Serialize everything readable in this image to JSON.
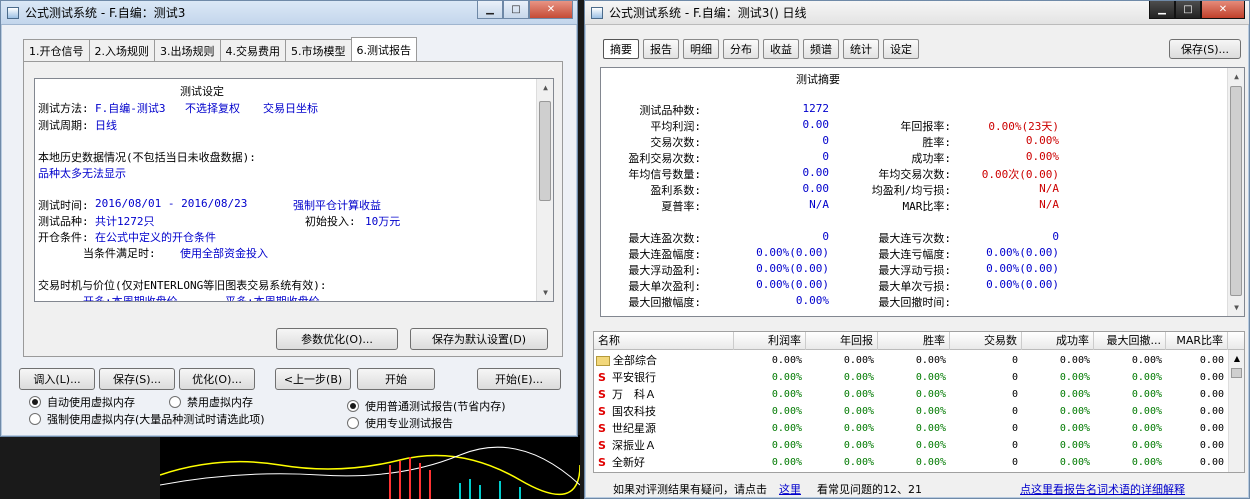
{
  "left_window": {
    "title": "公式测试系统 - F.自编：测试3",
    "tabs": [
      "1.开仓信号",
      "2.入场规则",
      "3.出场规则",
      "4.交易费用",
      "5.市场模型",
      "6.测试报告"
    ],
    "active_tab": 5,
    "report": {
      "heading": "测试设定",
      "method_label": "测试方法:",
      "method_value": "F.自编-测试3",
      "method_extra1": "不选择复权",
      "method_extra2": "交易日坐标",
      "period_label": "测试周期:",
      "period_value": "日线",
      "local_data_note": "本地历史数据情况(不包括当日未收盘数据):",
      "too_many": "品种太多无法显示",
      "time_label": "测试时间:",
      "time_value": "2016/08/01 - 2016/08/23",
      "force_close": "强制平仓计算收益",
      "products_label": "测试品种:",
      "products_value": "共计1272只",
      "initial_label": "初始投入:",
      "initial_value": "10万元",
      "open_label": "开仓条件:",
      "open_value": "在公式中定义的开仓条件",
      "when_met_label": "当条件满足时:",
      "when_met_value": "使用全部资金投入",
      "timing_note": "交易时机与价位(仅对ENTERLONG等旧图表交易系统有效):",
      "open_long": "开多:本周期收盘价",
      "close_long": "平多:本周期收盘价"
    },
    "buttons": {
      "optimize_params": "参数优化(O)...",
      "save_default": "保存为默认设置(D)",
      "load": "调入(L)...",
      "save": "保存(S)...",
      "optimize": "优化(O)...",
      "prev": "<上一步(B)",
      "start": "开始",
      "start_more": "开始(E)..."
    },
    "radios": {
      "auto_vm": "自动使用虚拟内存",
      "no_vm": "禁用虚拟内存",
      "force_vm": "强制使用虚拟内存(大量品种测试时请选此项)",
      "normal_report": "使用普通测试报告(节省内存)",
      "pro_report": "使用专业测试报告"
    }
  },
  "right_window": {
    "title": "公式测试系统 - F.自编：测试3() 日线",
    "tabs": [
      "摘要",
      "报告",
      "明细",
      "分布",
      "收益",
      "频谱",
      "统计",
      "设定"
    ],
    "active_tab": 0,
    "save_button": "保存(S)...",
    "summary": {
      "title": "测试摘要",
      "left": [
        {
          "label": "测试品种数:",
          "value": "1272"
        },
        {
          "label": "平均利润:",
          "value": "0.00"
        },
        {
          "label": "交易次数:",
          "value": "0"
        },
        {
          "label": "盈利交易次数:",
          "value": "0"
        },
        {
          "label": "年均信号数量:",
          "value": "0.00"
        },
        {
          "label": "盈利系数:",
          "value": "0.00"
        },
        {
          "label": "夏普率:",
          "value": "N/A"
        }
      ],
      "right": [
        {
          "label": "年回报率:",
          "value": "0.00%(23天)"
        },
        {
          "label": "胜率:",
          "value": "0.00%"
        },
        {
          "label": "成功率:",
          "value": "0.00%"
        },
        {
          "label": "年均交易次数:",
          "value": "0.00次(0.00)"
        },
        {
          "label": "均盈利/均亏损:",
          "value": "N/A"
        },
        {
          "label": "MAR比率:",
          "value": "N/A"
        }
      ],
      "left2": [
        {
          "label": "最大连盈次数:",
          "value": "0"
        },
        {
          "label": "最大连盈幅度:",
          "value": "0.00%(0.00)"
        },
        {
          "label": "最大浮动盈利:",
          "value": "0.00%(0.00)"
        },
        {
          "label": "最大单次盈利:",
          "value": "0.00%(0.00)"
        },
        {
          "label": "最大回撤幅度:",
          "value": "0.00%"
        }
      ],
      "right2": [
        {
          "label": "最大连亏次数:",
          "value": "0"
        },
        {
          "label": "最大连亏幅度:",
          "value": "0.00%(0.00)"
        },
        {
          "label": "最大浮动亏损:",
          "value": "0.00%(0.00)"
        },
        {
          "label": "最大单次亏损:",
          "value": "0.00%(0.00)"
        },
        {
          "label": "最大回撤时间:",
          "value": ""
        }
      ]
    },
    "grid": {
      "columns": [
        "名称",
        "利润率",
        "年回报",
        "胜率",
        "交易数",
        "成功率",
        "最大回撤...",
        "MAR比率"
      ],
      "rows": [
        {
          "name": "全部综合",
          "icon": "folder-icon",
          "values": [
            "0.00%",
            "0.00%",
            "0.00%",
            "0",
            "0.00%",
            "0.00%",
            "0.00"
          ]
        },
        {
          "name": "平安银行",
          "icon": "stock-icon",
          "values": [
            "0.00%",
            "0.00%",
            "0.00%",
            "0",
            "0.00%",
            "0.00%",
            "0.00"
          ]
        },
        {
          "name": "万　科Ａ",
          "icon": "stock-icon",
          "values": [
            "0.00%",
            "0.00%",
            "0.00%",
            "0",
            "0.00%",
            "0.00%",
            "0.00"
          ]
        },
        {
          "name": "国农科技",
          "icon": "stock-icon",
          "values": [
            "0.00%",
            "0.00%",
            "0.00%",
            "0",
            "0.00%",
            "0.00%",
            "0.00"
          ]
        },
        {
          "name": "世纪星源",
          "icon": "stock-icon",
          "values": [
            "0.00%",
            "0.00%",
            "0.00%",
            "0",
            "0.00%",
            "0.00%",
            "0.00"
          ]
        },
        {
          "name": "深振业Ａ",
          "icon": "stock-icon",
          "values": [
            "0.00%",
            "0.00%",
            "0.00%",
            "0",
            "0.00%",
            "0.00%",
            "0.00"
          ]
        },
        {
          "name": "全新好",
          "icon": "stock-icon",
          "values": [
            "0.00%",
            "0.00%",
            "0.00%",
            "0",
            "0.00%",
            "0.00%",
            "0.00"
          ]
        }
      ]
    },
    "footer": {
      "question": "如果对评测结果有疑问，请点击",
      "here": "这里",
      "faq": "看常见问题的12、21",
      "glossary": "点这里看报告名词术语的详细解释"
    }
  },
  "colors": {
    "blue_text": "#0000cc",
    "red_text": "#cc0000",
    "green_text": "#007a00",
    "stock_icon": "#e00000"
  }
}
